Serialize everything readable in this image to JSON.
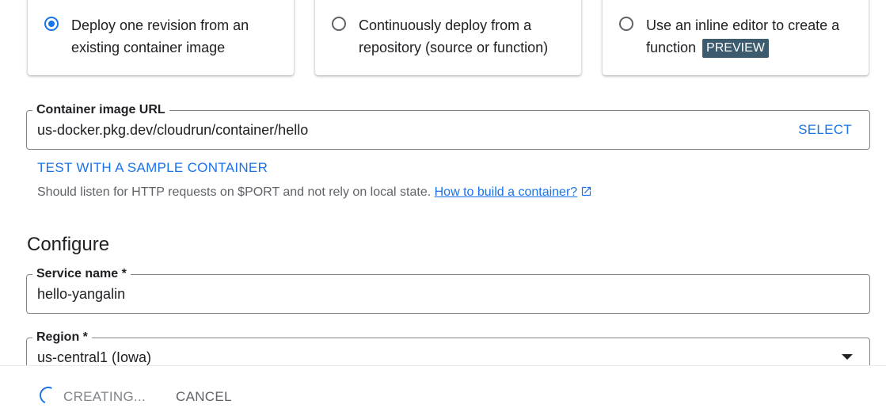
{
  "source_options": {
    "items": [
      {
        "label": "Deploy one revision from an existing container image",
        "selected": true
      },
      {
        "label": "Continuously deploy from a repository (source or function)",
        "selected": false
      },
      {
        "label": "Use an inline editor to create a function",
        "badge": "PREVIEW",
        "selected": false
      }
    ]
  },
  "container_image": {
    "legend": "Container image URL",
    "value": "us-docker.pkg.dev/cloudrun/container/hello",
    "select_label": "SELECT"
  },
  "sample_container_label": "TEST WITH A SAMPLE CONTAINER",
  "help": {
    "text": "Should listen for HTTP requests on $PORT and not rely on local state.",
    "link_label": "How to build a container?"
  },
  "configure": {
    "title": "Configure",
    "service_name": {
      "legend": "Service name *",
      "value": "hello-yangalin"
    },
    "region": {
      "legend": "Region *",
      "value": "us-central1 (Iowa)"
    }
  },
  "actions": {
    "create_label": "CREATING...",
    "cancel_label": "CANCEL"
  },
  "colors": {
    "accent": "#1a73e8",
    "badge_bg": "#3c5b6e",
    "text_primary": "#202124",
    "text_secondary": "#5f6368"
  }
}
